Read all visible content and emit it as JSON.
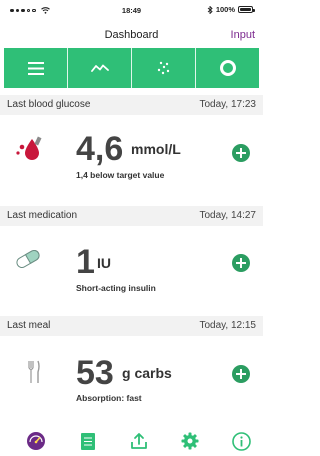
{
  "status_bar": {
    "time": "18:49",
    "battery_text": "100%",
    "battery_level": 1.0
  },
  "nav": {
    "title": "Dashboard",
    "input_label": "Input"
  },
  "tabs": [
    {
      "icon": "menu-icon"
    },
    {
      "icon": "trend-icon"
    },
    {
      "icon": "scatter-icon"
    },
    {
      "icon": "ring-icon"
    }
  ],
  "glucose": {
    "label": "Last blood glucose",
    "time": "Today, 17:23",
    "value": "4,6",
    "unit": "mmol/L",
    "note": "1,4 below target value",
    "icon": "blood-drop-icon"
  },
  "medication": {
    "label": "Last medication",
    "time": "Today, 14:27",
    "value": "1",
    "unit": "IU",
    "note": "Short-acting insulin",
    "icon": "pill-icon"
  },
  "meal": {
    "label": "Last meal",
    "time": "Today, 12:15",
    "value": "53",
    "unit": "g carbs",
    "note": "Absorption: fast",
    "icon": "cutlery-icon"
  },
  "bottom_bar": [
    {
      "icon": "dashboard-icon"
    },
    {
      "icon": "logbook-icon"
    },
    {
      "icon": "export-icon"
    },
    {
      "icon": "settings-icon"
    },
    {
      "icon": "info-icon"
    }
  ],
  "colors": {
    "accent": "#2fbf77",
    "plus": "#2b9d61",
    "input": "#7c2a8f",
    "drop": "#c8173b"
  }
}
